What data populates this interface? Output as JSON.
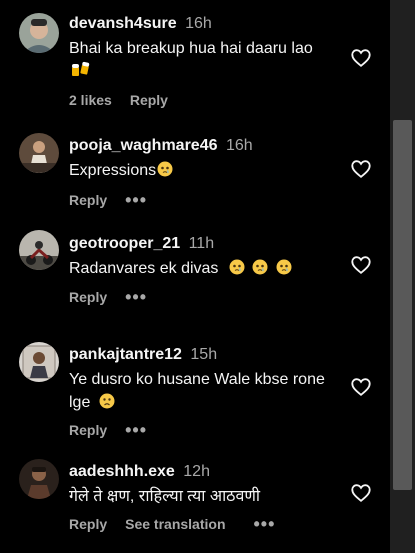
{
  "comments": [
    {
      "username": "devansh4sure",
      "time": "16h",
      "text": "Bhai ka breakup hua hai daaru lao",
      "emoji": "beer-mugs-icon",
      "likes": "2 likes",
      "reply": "Reply",
      "avatar": "avatar-photo"
    },
    {
      "username": "pooja_waghmare46",
      "time": "16h",
      "text": "Expressions",
      "emoji": "crying-face-icon",
      "reply": "Reply",
      "avatar": "avatar-photo"
    },
    {
      "username": "geotrooper_21",
      "time": "11h",
      "text": "Radanvares ek divas",
      "emoji": "crying-face-icon",
      "reply": "Reply",
      "avatar": "avatar-photo"
    },
    {
      "username": "pankajtantre12",
      "time": "15h",
      "text": "Ye dusro ko husane Wale kbse rone lge",
      "emoji": "worried-face-icon",
      "reply": "Reply",
      "avatar": "avatar-photo"
    },
    {
      "username": "aadeshhh.exe",
      "time": "12h",
      "text": "गेले ते क्षण, राहिल्या त्या आठवणी",
      "reply": "Reply",
      "see_translation": "See translation",
      "avatar": "avatar-photo"
    }
  ],
  "colors": {
    "background": "#000000",
    "text": "#f5f5f5",
    "muted": "#a8a8a8",
    "scrollbar": "#595959"
  }
}
